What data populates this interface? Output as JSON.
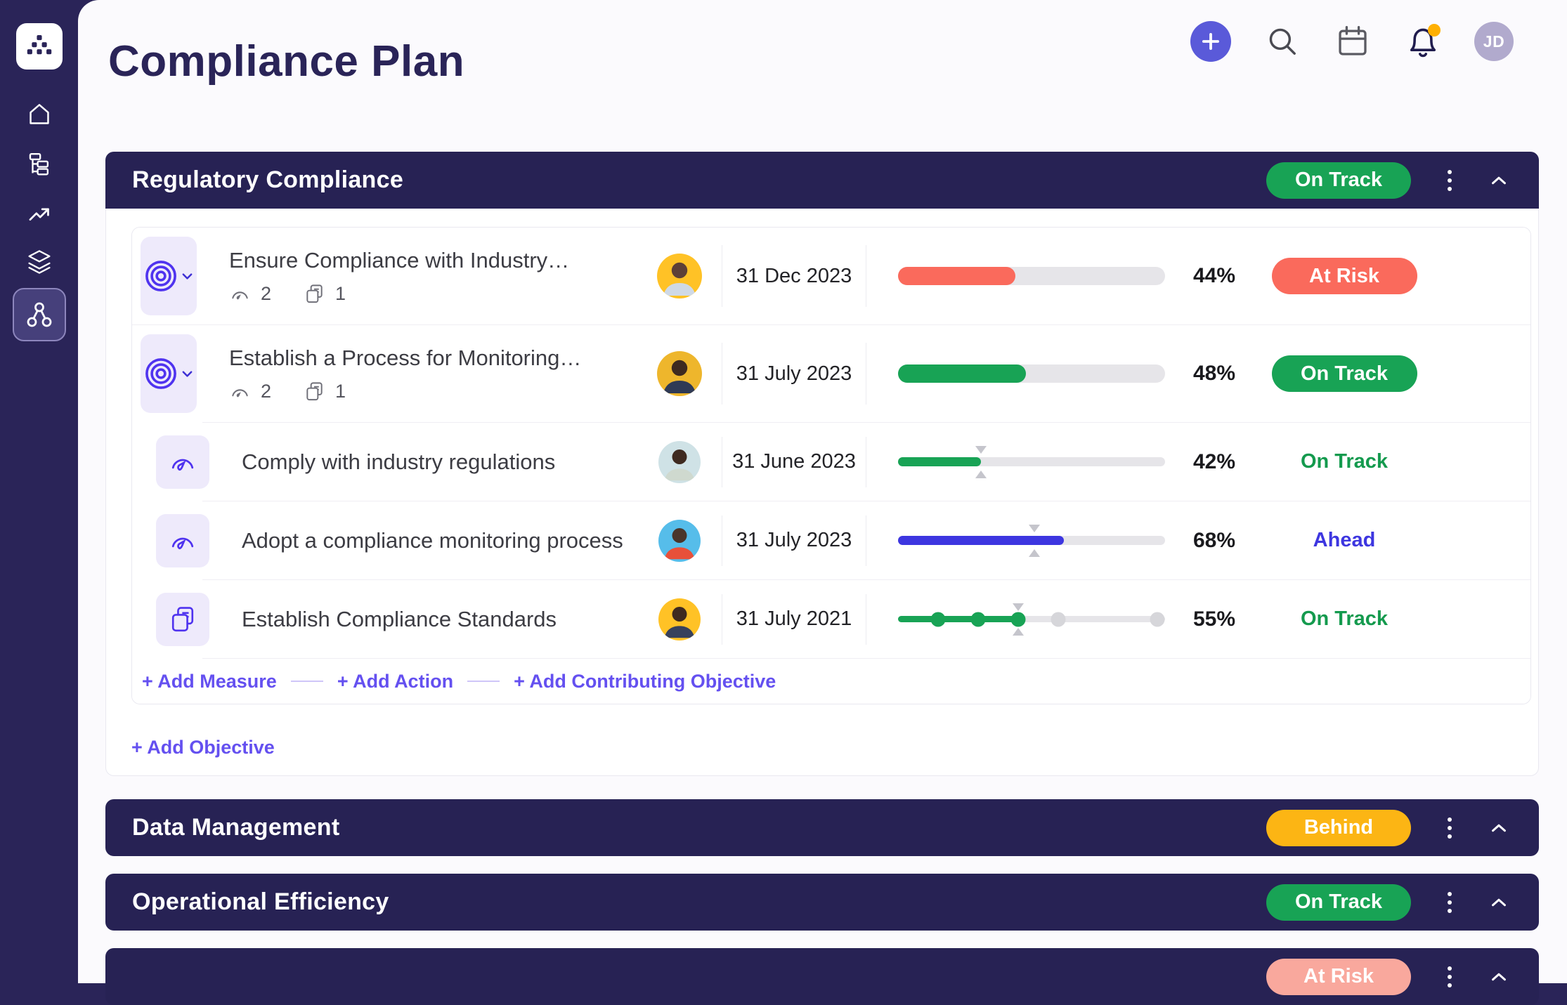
{
  "colors": {
    "navy": "#2a2458",
    "header_bar": "#272254",
    "green": "#18a355",
    "green_text": "#149a4e",
    "red": "#fa6a5c",
    "red_light": "#f9a89d",
    "amber": "#fcb514",
    "indigo": "#3d36e0",
    "link_purple": "#6450f0",
    "icon_purple": "#4f33ef",
    "accent_purple": "#5a5ad9",
    "notification_dot": "#ffb002",
    "track_gray": "#e6e5e9",
    "pending_dot": "#d6d6da"
  },
  "page": {
    "title": "Compliance Plan"
  },
  "topbar": {
    "avatar_initials": "JD",
    "icons": [
      "plus",
      "search",
      "calendar",
      "bell-with-badge",
      "avatar"
    ]
  },
  "sidebar": {
    "logo_icon": "dot-hierarchy-logo",
    "items": [
      "home",
      "hierarchy",
      "trend-up",
      "layers",
      "share-nodes"
    ],
    "active_item": "share-nodes"
  },
  "sections": [
    {
      "title": "Regulatory Compliance",
      "status": "On Track",
      "rows": [
        {
          "kind": "objective",
          "icon": "bullseye",
          "title": "Ensure Compliance with Industry…",
          "measure_count": "2",
          "action_count": "1",
          "due_date": "31 Dec 2023",
          "percent": "44%",
          "progress": {
            "type": "bar",
            "fill": 44
          },
          "status": "At Risk"
        },
        {
          "kind": "objective",
          "icon": "bullseye",
          "title": "Establish a Process for Monitoring…",
          "measure_count": "2",
          "action_count": "1",
          "due_date": "31 July 2023",
          "percent": "48%",
          "progress": {
            "type": "bar",
            "fill": 48
          },
          "status": "On Track"
        },
        {
          "kind": "measure",
          "icon": "gauge",
          "title": "Comply with industry regulations",
          "due_date": "31 June 2023",
          "percent": "42%",
          "progress": {
            "type": "slider",
            "fill": 31,
            "target": 31
          },
          "status": "On Track"
        },
        {
          "kind": "measure",
          "icon": "gauge",
          "title": "Adopt a compliance monitoring process",
          "due_date": "31 July 2023",
          "percent": "68%",
          "progress": {
            "type": "slider",
            "fill": 62,
            "target": 51
          },
          "status": "Ahead"
        },
        {
          "kind": "action",
          "icon": "pages",
          "title": "Establish Compliance Standards",
          "due_date": "31 July 2021",
          "percent": "55%",
          "progress": {
            "type": "milestones",
            "fill": 45,
            "target": 45,
            "dots": [
              {
                "pos": 15,
                "done": true
              },
              {
                "pos": 30,
                "done": true
              },
              {
                "pos": 45,
                "done": true
              },
              {
                "pos": 60,
                "done": false
              },
              {
                "pos": 97,
                "done": false
              }
            ]
          },
          "status": "On Track"
        }
      ],
      "footer_links": [
        {
          "label": "+ Add Measure"
        },
        {
          "label": "+ Add Action"
        },
        {
          "label": "+ Add Contributing Objective"
        }
      ],
      "add_objective_label": "+ Add Objective"
    },
    {
      "title": "Data Management",
      "status": "Behind"
    },
    {
      "title": "Operational Efficiency",
      "status": "On Track"
    },
    {
      "title": "",
      "status": "At Risk"
    }
  ]
}
